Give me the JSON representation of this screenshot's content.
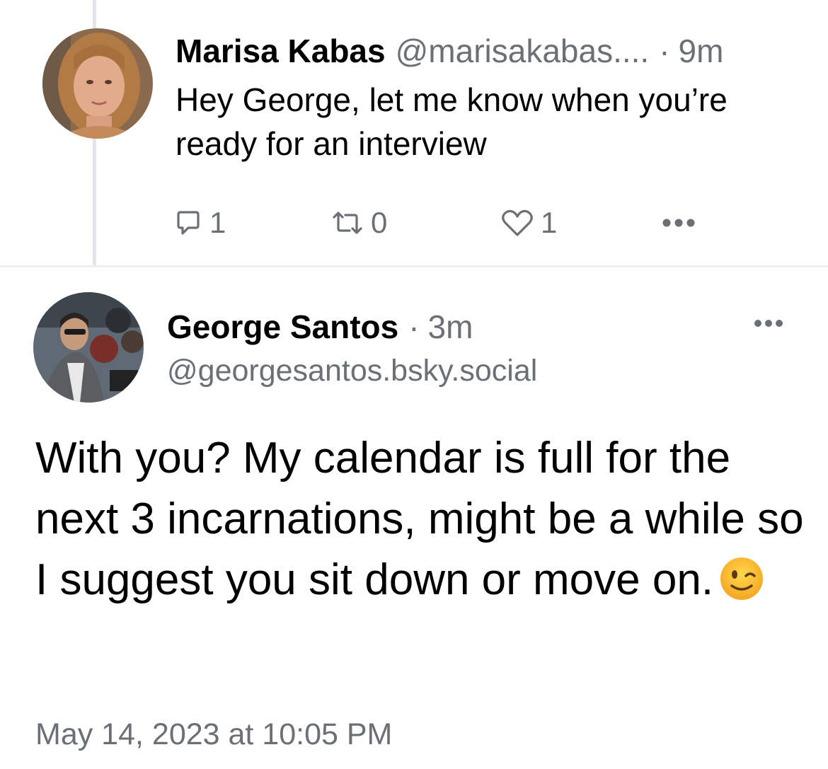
{
  "parent_post": {
    "author_name": "Marisa Kabas",
    "handle": "@marisakabas....",
    "separator": "·",
    "time": "9m",
    "text": "Hey George, let me know when you’re ready for an interview",
    "actions": {
      "reply_count": "1",
      "repost_count": "0",
      "like_count": "1"
    }
  },
  "main_post": {
    "author_name": "George Santos",
    "separator": "·",
    "time": "3m",
    "handle": "@georgesantos.bsky.social",
    "text": "With you? My calendar is full for the next 3 incarnations, might be a while so I suggest you sit down or move on.",
    "emoji": "winking-face",
    "timestamp": "May 14, 2023 at 10:05 PM"
  },
  "colors": {
    "secondary_text": "#6b6f76",
    "divider": "#eceef0",
    "thread_line": "#e3e5e8"
  }
}
